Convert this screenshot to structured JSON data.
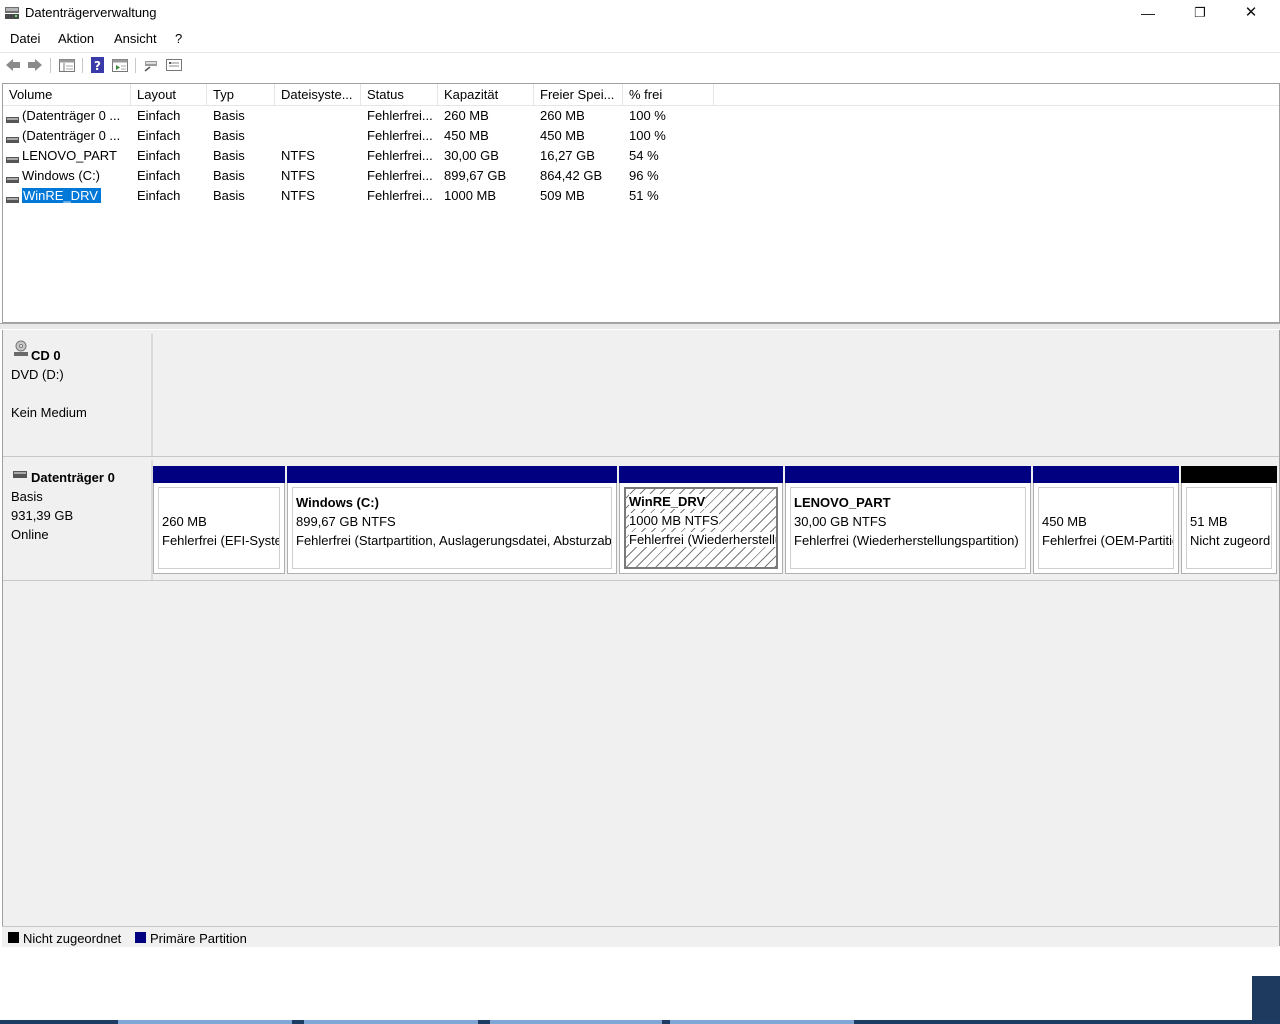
{
  "window": {
    "title": "Datenträgerverwaltung",
    "min": "—",
    "max": "❐",
    "close": "✕"
  },
  "menu": [
    "Datei",
    "Aktion",
    "Ansicht",
    "?"
  ],
  "toolbar": [
    "back-icon",
    "forward-icon",
    "list-view-icon",
    "help-icon",
    "properties-icon",
    "connect-icon",
    "settings-icon"
  ],
  "columns": [
    "Volume",
    "Layout",
    "Typ",
    "Dateisyste...",
    "Status",
    "Kapazität",
    "Freier Spei...",
    "% frei"
  ],
  "volumes": [
    {
      "volume": "(Datenträger 0 ...",
      "layout": "Einfach",
      "typ": "Basis",
      "fs": "",
      "status": "Fehlerfrei...",
      "kap": "260 MB",
      "frei": "260 MB",
      "pct": "100 %"
    },
    {
      "volume": "(Datenträger 0 ...",
      "layout": "Einfach",
      "typ": "Basis",
      "fs": "",
      "status": "Fehlerfrei...",
      "kap": "450 MB",
      "frei": "450 MB",
      "pct": "100 %"
    },
    {
      "volume": "LENOVO_PART",
      "layout": "Einfach",
      "typ": "Basis",
      "fs": "NTFS",
      "status": "Fehlerfrei...",
      "kap": "30,00 GB",
      "frei": "16,27 GB",
      "pct": "54 %"
    },
    {
      "volume": "Windows (C:)",
      "layout": "Einfach",
      "typ": "Basis",
      "fs": "NTFS",
      "status": "Fehlerfrei...",
      "kap": "899,67 GB",
      "frei": "864,42 GB",
      "pct": "96 %"
    },
    {
      "volume": "WinRE_DRV",
      "layout": "Einfach",
      "typ": "Basis",
      "fs": "NTFS",
      "status": "Fehlerfrei...",
      "kap": "1000 MB",
      "frei": "509 MB",
      "pct": "51 %"
    }
  ],
  "cd": {
    "title": "CD 0",
    "line1": "DVD (D:)",
    "line2": "Kein Medium"
  },
  "disk0": {
    "title": "Datenträger 0",
    "line1": "Basis",
    "line2": "931,39 GB",
    "line3": "Online"
  },
  "partitions": [
    {
      "name": "",
      "size": "260 MB",
      "status": "Fehlerfrei (EFI-Systempartition)"
    },
    {
      "name": "Windows  (C:)",
      "size": "899,67 GB NTFS",
      "status": "Fehlerfrei (Startpartition, Auslagerungsdatei, Absturzabbild, Standarddatenpartition)"
    },
    {
      "name": "WinRE_DRV",
      "size": "1000 MB NTFS",
      "status": "Fehlerfrei (Wiederherstellungspartition)"
    },
    {
      "name": "LENOVO_PART",
      "size": "30,00 GB NTFS",
      "status": "Fehlerfrei (Wiederherstellungspartition)"
    },
    {
      "name": "",
      "size": "450 MB",
      "status": "Fehlerfrei (OEM-Partition)"
    },
    {
      "name": "",
      "size": "51 MB",
      "status": "Nicht zugeordnet"
    }
  ],
  "legend": {
    "unalloc": "Nicht zugeordnet",
    "primary": "Primäre Partition"
  },
  "colors": {
    "primary": "#000080",
    "unallocated": "#000000",
    "selection": "#0078d7"
  }
}
